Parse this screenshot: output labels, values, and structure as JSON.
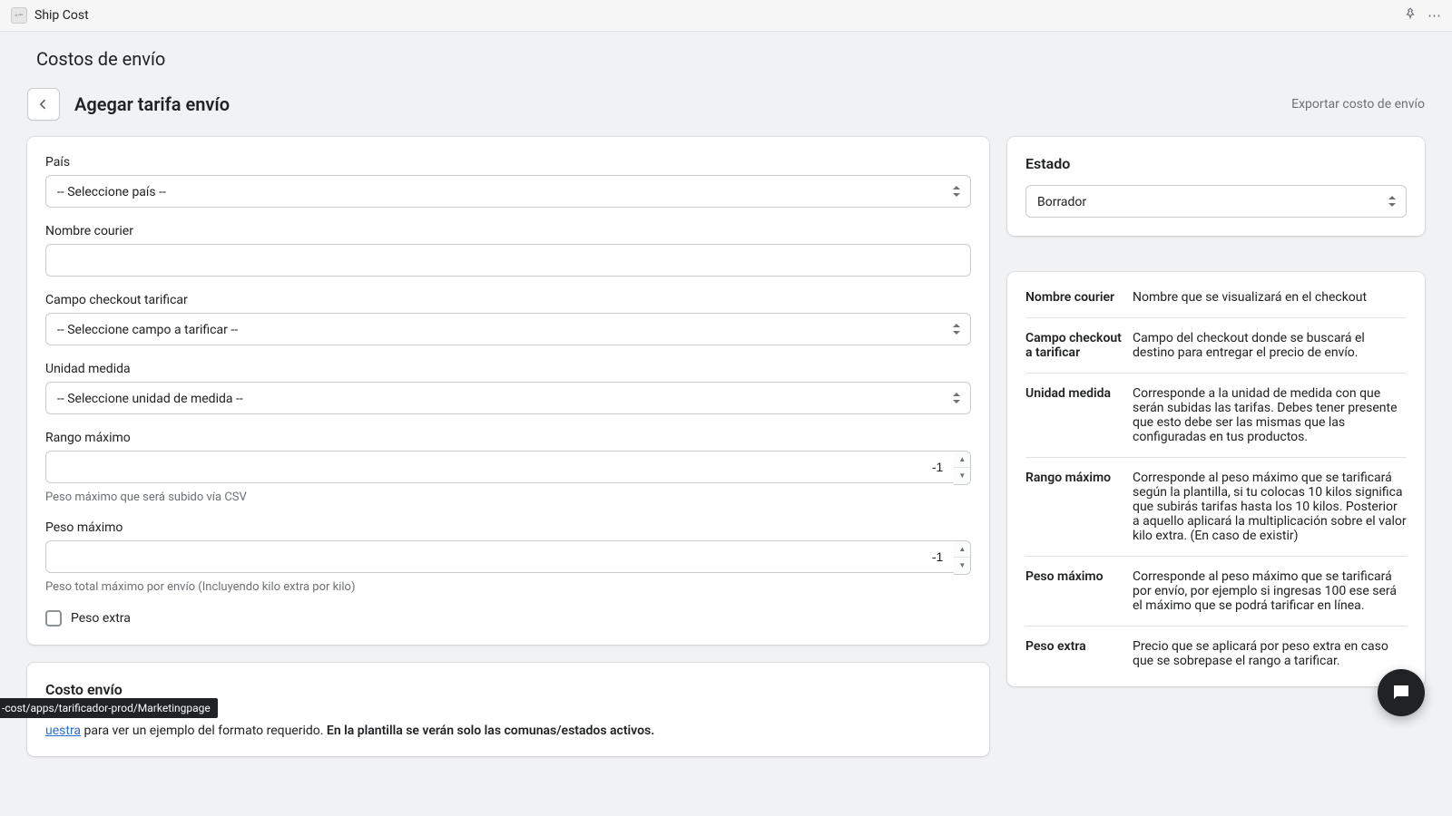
{
  "appbar": {
    "title": "Ship Cost"
  },
  "section": {
    "heading": "Costos de envío"
  },
  "page": {
    "title": "Agegar tarifa envío",
    "export_link": "Exportar costo de envío"
  },
  "form": {
    "pais": {
      "label": "País",
      "selected": "-- Seleccione país --"
    },
    "courier": {
      "label": "Nombre courier",
      "value": ""
    },
    "campo": {
      "label": "Campo checkout tarificar",
      "selected": "-- Seleccione campo a tarificar --"
    },
    "unidad": {
      "label": "Unidad medida",
      "selected": "-- Seleccione unidad de medida --"
    },
    "rango": {
      "label": "Rango máximo",
      "value": "-1",
      "help": "Peso máximo que será subido vía CSV"
    },
    "peso": {
      "label": "Peso máximo",
      "value": "-1",
      "help": "Peso total máximo por envío (Incluyendo kilo extra por kilo)"
    },
    "extra": {
      "label": "Peso extra"
    }
  },
  "status": {
    "heading": "Estado",
    "selected": "Borrador"
  },
  "info": [
    {
      "term": "Nombre courier",
      "desc": "Nombre que se visualizará en el checkout"
    },
    {
      "term": "Campo checkout a tarificar",
      "desc": "Campo del checkout donde se buscará el destino para entregar el precio de envío."
    },
    {
      "term": "Unidad medida",
      "desc": "Corresponde a la unidad de medida con que serán subidas las tarifas. Debes tener presente que esto debe ser las mismas que las configuradas en tus productos."
    },
    {
      "term": "Rango máximo",
      "desc": "Corresponde al peso máximo que se tarificará según la plantilla, si tu colocas 10 kilos significa que subirás tarifas hasta los 10 kilos. Posterior a aquello aplicará la multiplicación sobre el valor kilo extra. (En caso de existir)"
    },
    {
      "term": "Peso máximo",
      "desc": "Corresponde al peso máximo que se tarificará por envío, por ejemplo si ingresas 100 ese será el máximo que se podrá tarificar en línea."
    },
    {
      "term": "Peso extra",
      "desc": "Precio que se aplicará por peso extra en caso que se sobrepase el rango a tarificar."
    }
  ],
  "cost": {
    "heading": "Costo envío",
    "link_text": "uestra",
    "text_after_link": " para ver un ejemplo del formato requerido. ",
    "bold": "En la plantilla se verán solo las comunas/estados activos."
  },
  "statusbar": "-cost/apps/tarificador-prod/Marketingpage"
}
